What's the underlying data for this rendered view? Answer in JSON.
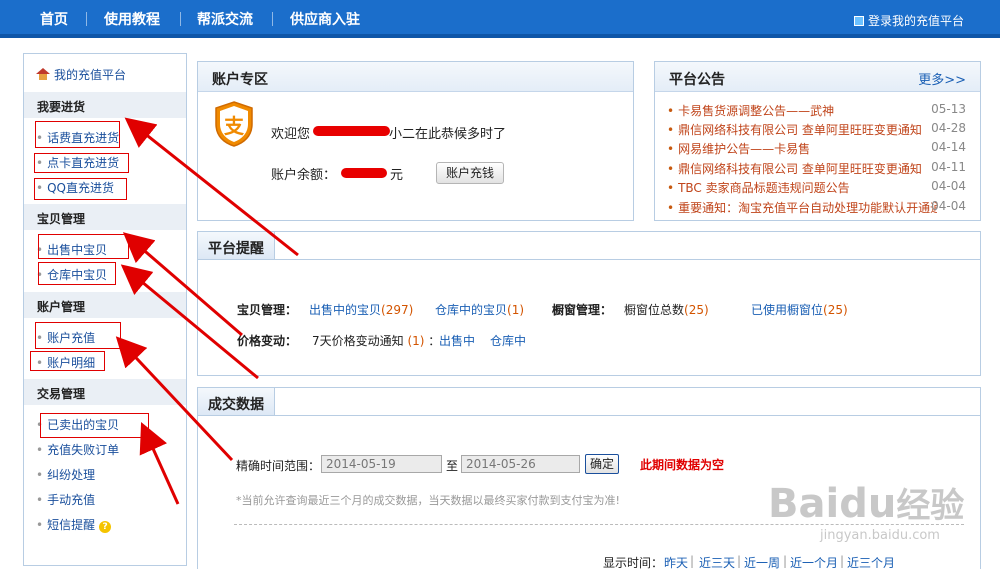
{
  "nav": {
    "items": [
      "首页",
      "使用教程",
      "帮派交流",
      "供应商入驻"
    ],
    "login_label": "登录我的充值平台"
  },
  "sidebar": {
    "home_label": "我的充值平台",
    "groups": [
      {
        "title": "我要进货",
        "items": [
          "话费直充进货",
          "点卡直充进货",
          "QQ直充进货"
        ]
      },
      {
        "title": "宝贝管理",
        "items": [
          "出售中宝贝",
          "仓库中宝贝"
        ]
      },
      {
        "title": "账户管理",
        "items": [
          "账户充值",
          "账户明细"
        ]
      },
      {
        "title": "交易管理",
        "items": [
          "已卖出的宝贝",
          "充值失败订单",
          "纠纷处理",
          "手动充值",
          "短信提醒"
        ]
      }
    ],
    "help_icon": "help-circle-icon"
  },
  "account": {
    "title": "账户专区",
    "welcome_prefix": "欢迎您",
    "welcome_suffix": "小二在此恭候多时了",
    "balance_label": "账户余额：",
    "balance_unit": "元",
    "recharge_button": "账户充钱",
    "logo_icon": "alipay-logo-icon"
  },
  "announcements": {
    "title": "平台公告",
    "more_label": "更多>>",
    "items": [
      {
        "text": "卡易售货源调整公告——武神",
        "date": "05-13"
      },
      {
        "text": "鼎信网络科技有限公司 查单阿里旺旺变更通知",
        "date": "04-28"
      },
      {
        "text": "网易维护公告——卡易售",
        "date": "04-14"
      },
      {
        "text": "鼎信网络科技有限公司 查单阿里旺旺变更通知",
        "date": "04-11"
      },
      {
        "text": "TBC 卖家商品标题违规问题公告",
        "date": "04-04"
      },
      {
        "text": "重要通知：淘宝充值平台自动处理功能默认开通通",
        "date": "04-04"
      }
    ]
  },
  "reminders": {
    "title": "平台提醒",
    "baobei_label": "宝贝管理：",
    "on_sale_label": "出售中的宝贝",
    "on_sale_count": "(297)",
    "warehouse_label": "仓库中的宝贝",
    "warehouse_count": "(1)",
    "window_label": "橱窗管理：",
    "window_total_label": "橱窗位总数",
    "window_total_count": "(25)",
    "window_used_label": "已使用橱窗位",
    "window_used_count": "(25)",
    "price_label": "价格变动：",
    "price_notice_label": "7天价格变动通知",
    "price_notice_count": "(1)",
    "price_colon": "：",
    "price_on_sale": "出售中",
    "price_warehouse": "仓库中"
  },
  "transactions": {
    "title": "成交数据",
    "range_label": "精确时间范围：",
    "start_date": "2014-05-19",
    "to_label": "至",
    "end_date": "2014-05-26",
    "confirm_button": "确定",
    "empty_message": "此期间数据为空",
    "note": "*当前允许查询最近三个月的成交数据，当天数据以最终买家付款到支付宝为准!",
    "display_label": "显示时间：",
    "periods": [
      "昨天",
      "近三天",
      "近一周",
      "近一个月",
      "近三个月"
    ],
    "period_sep": "|"
  },
  "watermark": {
    "brand": "Baidu",
    "brand_cn": "经验",
    "url": "jingyan.baidu.com"
  },
  "colors": {
    "nav_bg": "#1b6ecb",
    "annotation_red": "#e00000",
    "link_blue": "#1a5fb4",
    "count_orange": "#d35400"
  }
}
